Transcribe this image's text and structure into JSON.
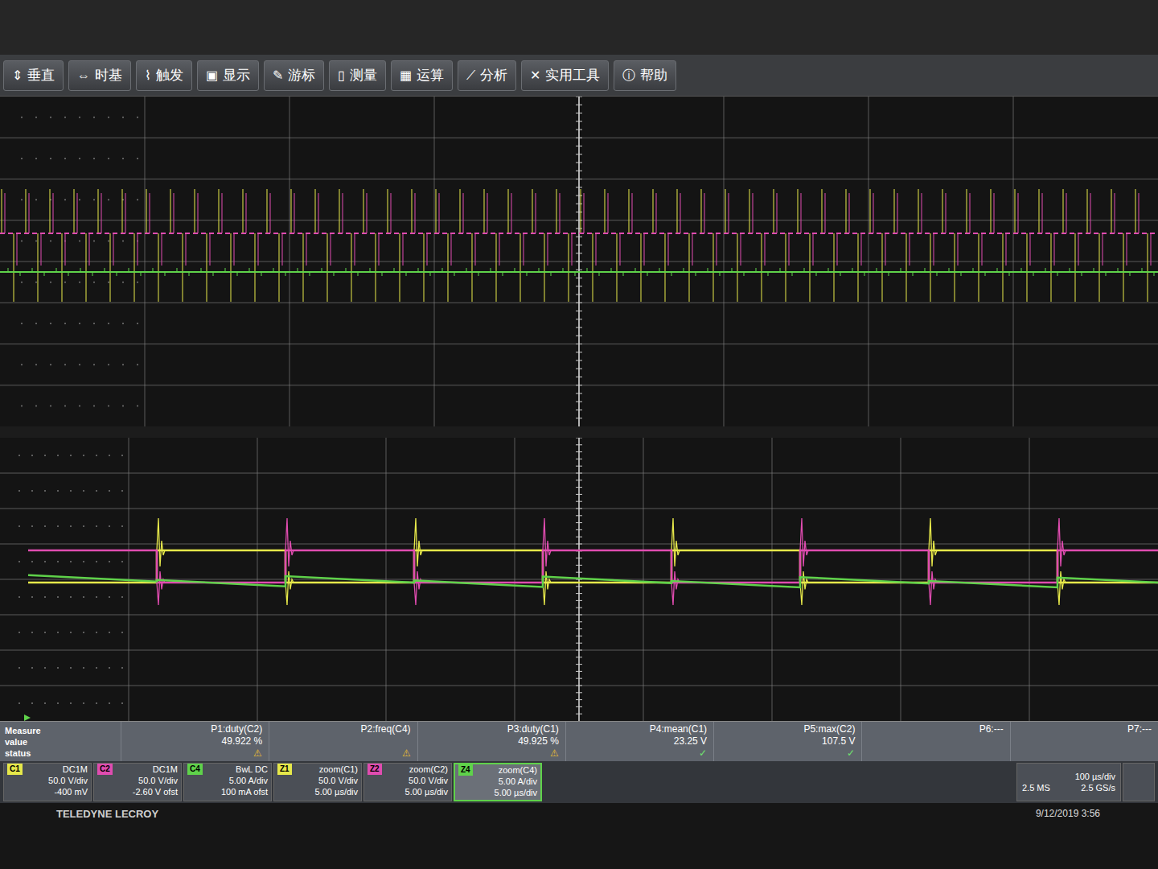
{
  "window": {
    "title": "TELEDYNE LECROY",
    "timestamp": "9/12/2019 3:56"
  },
  "menu": [
    {
      "icon": "⇕",
      "label": "垂直"
    },
    {
      "icon": "⇔",
      "label": "时基"
    },
    {
      "icon": "⌇",
      "label": "触发"
    },
    {
      "icon": "▣",
      "label": "显示"
    },
    {
      "icon": "✎",
      "label": "游标"
    },
    {
      "icon": "▯",
      "label": "测量"
    },
    {
      "icon": "▦",
      "label": "运算"
    },
    {
      "icon": "⟋",
      "label": "分析"
    },
    {
      "icon": "✕",
      "label": "实用工具"
    },
    {
      "icon": "ⓘ",
      "label": "帮助"
    }
  ],
  "upper_chart": {
    "series": [
      {
        "name": "C1",
        "color": "#e6e84a",
        "baseline": 0,
        "spike_high": 55,
        "spike_low": -85,
        "edges": 96
      },
      {
        "name": "C2",
        "color": "#e04cb0",
        "baseline": 0,
        "spike_high": 50,
        "spike_low": -40,
        "edges": 96
      },
      {
        "name": "C4",
        "color": "#5fd24a",
        "baseline": -48,
        "spike_high": -43,
        "spike_low": -53,
        "edges": 96
      }
    ]
  },
  "zoom_chart": {
    "series": [
      {
        "name": "Z1",
        "color": "#e6e84a",
        "values": [
          0,
          46.5,
          0,
          46.5,
          0,
          46.5,
          0,
          46.5,
          0
        ]
      },
      {
        "name": "Z2",
        "color": "#e04cb0",
        "values": [
          46.5,
          0,
          46.5,
          0,
          46.5,
          0,
          46.5,
          0,
          46.5
        ]
      },
      {
        "name": "Z4",
        "color": "#5fd24a",
        "values": [
          1.2,
          0.2,
          1.0,
          0.1,
          0.9,
          0.0,
          0.8,
          0.0,
          0.7
        ]
      }
    ]
  },
  "measure": {
    "row_labels": [
      "Measure",
      "value",
      "status"
    ],
    "cells": [
      {
        "name": "P1:duty(C2)",
        "value": "49.922 %",
        "status": "⚠"
      },
      {
        "name": "P2:freq(C4)",
        "value": "",
        "status": "⚠"
      },
      {
        "name": "P3:duty(C1)",
        "value": "49.925 %",
        "status": "⚠"
      },
      {
        "name": "P4:mean(C1)",
        "value": "23.25 V",
        "status": "✓"
      },
      {
        "name": "P5:max(C2)",
        "value": "107.5 V",
        "status": "✓"
      },
      {
        "name": "P6:---",
        "value": "",
        "status": ""
      },
      {
        "name": "P7:---",
        "value": "",
        "status": ""
      }
    ]
  },
  "channels": [
    {
      "badge": "C1",
      "color": "#e6e84a",
      "coupling": "DC1M",
      "scale": "50.0 V/div",
      "offset": "-400 mV",
      "selected": false
    },
    {
      "badge": "C2",
      "color": "#e04cb0",
      "coupling": "DC1M",
      "scale": "50.0 V/div",
      "offset": "-2.60 V ofst",
      "selected": false
    },
    {
      "badge": "C4",
      "color": "#5fd24a",
      "coupling": "BwL DC",
      "scale": "5.00 A/div",
      "offset": "100 mA ofst",
      "selected": false
    },
    {
      "badge": "Z1",
      "color": "#e6e84a",
      "coupling": "zoom(C1)",
      "scale": "50.0 V/div",
      "offset": "5.00 µs/div",
      "selected": false
    },
    {
      "badge": "Z2",
      "color": "#e04cb0",
      "coupling": "zoom(C2)",
      "scale": "50.0 V/div",
      "offset": "5.00 µs/div",
      "selected": false
    },
    {
      "badge": "Z4",
      "color": "#5fd24a",
      "coupling": "zoom(C4)",
      "scale": "5.00 A/div",
      "offset": "5.00 µs/div",
      "selected": true
    }
  ],
  "timebase": {
    "samples": "2.5 MS",
    "scale": "100 µs/div",
    "rate": "2.5 GS/s"
  }
}
